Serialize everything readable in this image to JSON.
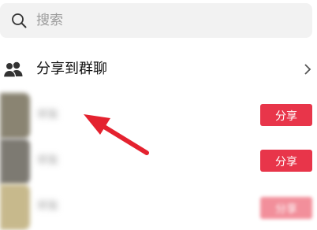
{
  "search": {
    "icon": "search-icon",
    "placeholder": "搜索"
  },
  "share_to_group": {
    "icon": "group-icon",
    "label": "分享到群聊",
    "chevron": "chevron-right-icon"
  },
  "friends": [
    {
      "name": "好友",
      "avatar_color": "#8a8472",
      "share_label": "分享"
    },
    {
      "name": "好友",
      "avatar_color": "#7d7a72",
      "share_label": "分享"
    },
    {
      "name": "好友",
      "avatar_color": "#c7b98c",
      "share_label": "分享"
    }
  ],
  "colors": {
    "accent": "#e8354a",
    "arrow": "#e4222f",
    "search_bg": "#f2f2f2"
  }
}
